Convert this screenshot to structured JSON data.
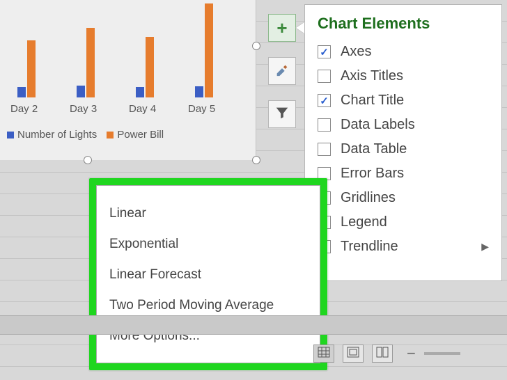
{
  "chart_data": {
    "type": "bar",
    "categories": [
      "Day 2",
      "Day 3",
      "Day 4",
      "Day 5"
    ],
    "series": [
      {
        "name": "Number of Lights",
        "color": "#3b5ec4",
        "values": [
          15,
          17,
          15,
          16
        ]
      },
      {
        "name": "Power Bill",
        "color": "#e67c2d",
        "values": [
          85,
          104,
          90,
          140
        ]
      }
    ],
    "ylim": [
      0,
      150
    ],
    "legend_position": "bottom"
  },
  "legend": {
    "series1": "Number of Lights",
    "series2": "Power Bill"
  },
  "xlabels": {
    "d2": "Day 2",
    "d3": "Day 3",
    "d4": "Day 4",
    "d5": "Day 5"
  },
  "tool_buttons": {
    "add": "plus-icon",
    "style": "brush-icon",
    "filter": "funnel-icon"
  },
  "chart_elements": {
    "title": "Chart Elements",
    "items": [
      {
        "label": "Axes",
        "checked": true
      },
      {
        "label": "Axis Titles",
        "checked": false
      },
      {
        "label": "Chart Title",
        "checked": true
      },
      {
        "label": "Data Labels",
        "checked": false
      },
      {
        "label": "Data Table",
        "checked": false
      },
      {
        "label": "Error Bars",
        "checked": false
      },
      {
        "label": "Gridlines",
        "checked": true
      },
      {
        "label": "Legend",
        "checked": true
      },
      {
        "label": "Trendline",
        "checked": false,
        "has_submenu": true
      }
    ]
  },
  "trendline_menu": {
    "items": [
      "Linear",
      "Exponential",
      "Linear Forecast",
      "Two Period Moving Average",
      "More Options..."
    ]
  },
  "view_buttons": {
    "normal": "grid-view-icon",
    "page_layout": "page-layout-icon",
    "page_break": "page-break-icon"
  }
}
